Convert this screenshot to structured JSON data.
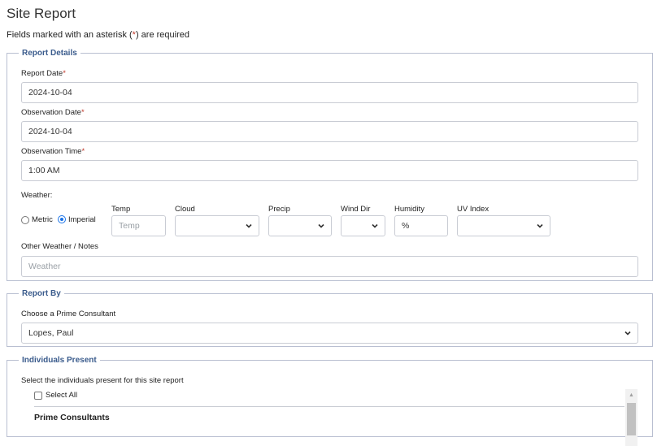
{
  "page": {
    "title": "Site Report",
    "required_note_before": "Fields marked with an asterisk (",
    "required_star": "*",
    "required_note_after": ") are required"
  },
  "report_details": {
    "legend": "Report Details",
    "report_date": {
      "label": "Report Date",
      "required": "*",
      "value": "2024-10-04"
    },
    "observation_date": {
      "label": "Observation Date",
      "required": "*",
      "value": "2024-10-04"
    },
    "observation_time": {
      "label": "Observation Time",
      "required": "*",
      "value": "1:00 AM"
    },
    "weather": {
      "label": "Weather:",
      "units": {
        "metric": "Metric",
        "imperial": "Imperial",
        "selected": "imperial"
      },
      "temp": {
        "label": "Temp",
        "placeholder": "Temp",
        "value": ""
      },
      "cloud": {
        "label": "Cloud",
        "value": ""
      },
      "precip": {
        "label": "Precip",
        "value": ""
      },
      "wind_dir": {
        "label": "Wind Dir",
        "value": ""
      },
      "humidity": {
        "label": "Humidity",
        "placeholder": "%",
        "value": ""
      },
      "uv_index": {
        "label": "UV Index",
        "value": ""
      }
    },
    "notes": {
      "label": "Other Weather / Notes",
      "placeholder": "Weather",
      "value": ""
    }
  },
  "report_by": {
    "legend": "Report By",
    "consultant_label": "Choose a Prime Consultant",
    "consultant_value": "Lopes, Paul"
  },
  "individuals_present": {
    "legend": "Individuals Present",
    "instruction": "Select the individuals present for this site report",
    "select_all": "Select All",
    "group_heading": "Prime Consultants"
  },
  "icons": {
    "select": "chevron-down-icon",
    "scroll": "scroll-up-arrow-icon"
  }
}
